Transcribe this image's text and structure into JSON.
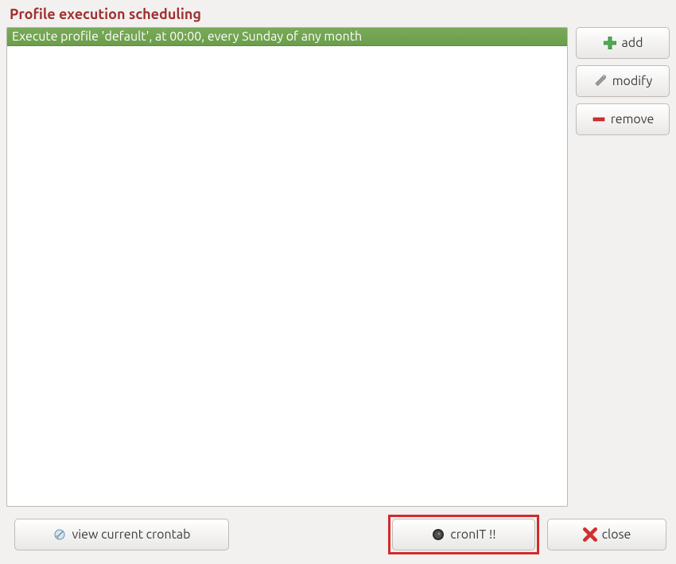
{
  "title": "Profile execution scheduling",
  "list": {
    "items": [
      {
        "label": "Execute profile 'default', at 00:00, every Sunday of any month"
      }
    ]
  },
  "buttons": {
    "add": "add",
    "modify": "modify",
    "remove": "remove",
    "view_crontab": "view current crontab",
    "cronit": "cronIT !!",
    "close": "close"
  },
  "colors": {
    "accent_title": "#a03030",
    "selected_bg": "#6b9d4a",
    "highlight_border": "#d22b2b"
  }
}
